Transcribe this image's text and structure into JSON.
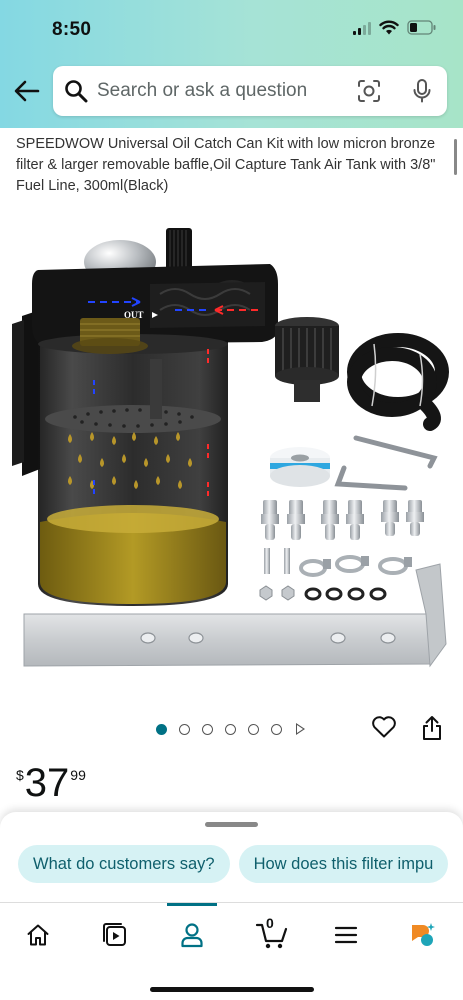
{
  "status_bar": {
    "time": "8:50",
    "icons": [
      "cellular-signal-icon",
      "wifi-icon",
      "battery-icon"
    ]
  },
  "header": {
    "back_icon": "arrow-left-icon",
    "search": {
      "placeholder": "Search or ask a question",
      "icons": [
        "search-icon",
        "camera-scan-icon",
        "microphone-icon"
      ]
    }
  },
  "product": {
    "title": "SPEEDWOW Universal Oil Catch Can Kit with low micron bronze filter & larger removable baffle,Oil Capture Tank Air Tank with 3/8\" Fuel Line, 300ml(Black)",
    "image_label": "OUT",
    "image_count": 6,
    "active_image": 1,
    "has_video": true,
    "price": {
      "currency": "$",
      "whole": "37",
      "fraction": "99"
    },
    "actions": [
      "heart-icon",
      "share-icon"
    ]
  },
  "bottom_sheet": {
    "chips": [
      {
        "label": "What do customers say?"
      },
      {
        "label": "How does this filter impu"
      }
    ]
  },
  "bottom_nav": {
    "items": [
      {
        "name": "home",
        "icon": "home-icon"
      },
      {
        "name": "inspire",
        "icon": "play-icon"
      },
      {
        "name": "account",
        "icon": "person-icon",
        "active": true
      },
      {
        "name": "cart",
        "icon": "cart-icon",
        "count": "0"
      },
      {
        "name": "menu",
        "icon": "hamburger-icon"
      },
      {
        "name": "rufus",
        "icon": "rufus-icon"
      }
    ]
  },
  "colors": {
    "accent": "#007185",
    "chip_bg": "#d6f2f4",
    "header_gradient_start": "#84d8e3",
    "header_gradient_end": "#a7e4c8",
    "oil": "#b59a1f",
    "rufus_orange": "#f08a24",
    "rufus_teal": "#1ea5b8"
  }
}
